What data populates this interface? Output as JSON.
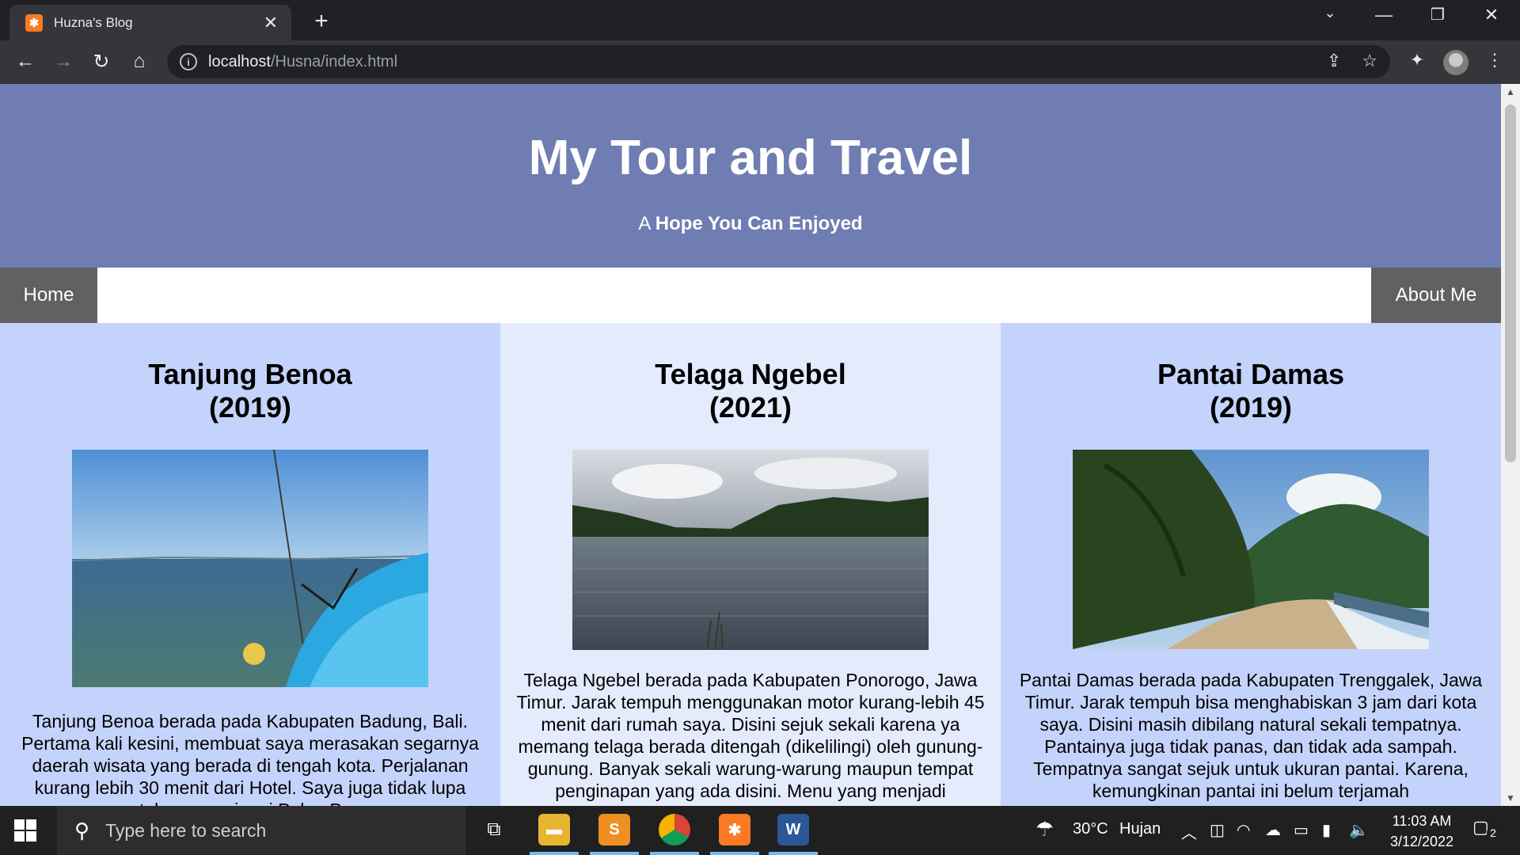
{
  "browser": {
    "tab_title": "Huzna's Blog",
    "tab_favicon": "xampp-icon",
    "url_host": "localhost",
    "url_path": "/Husna/index.html"
  },
  "site": {
    "title": "My Tour and Travel",
    "subtitle_prefix": "A",
    "subtitle_bold": "Hope You Can Enjoyed",
    "nav": {
      "home": "Home",
      "about": "About Me"
    },
    "colors": {
      "header_bg": "#6f7db3",
      "nav_button_bg": "#616161",
      "col_a": "#c4d3fb",
      "col_b": "#e4ebfd"
    }
  },
  "articles": [
    {
      "title_line1": "Tanjung Benoa",
      "title_line2": "(2019)",
      "text": "Tanjung Benoa berada pada Kabupaten Badung, Bali. Pertama kali kesini, membuat saya merasakan segarnya daerah wisata yang berada di tengah kota. Perjalanan kurang lebih 30 menit dari Hotel. Saya juga tidak lupa untuk mengunjungi Pulau Penyu"
    },
    {
      "title_line1": "Telaga Ngebel",
      "title_line2": "(2021)",
      "text": "Telaga Ngebel berada pada Kabupaten Ponorogo, Jawa Timur. Jarak tempuh menggunakan motor kurang-lebih 45 menit dari rumah saya. Disini sejuk sekali karena ya memang telaga berada ditengah (dikelilingi) oleh gunung-gunung. Banyak sekali warung-warung maupun tempat penginapan yang ada disini. Menu yang menjadi"
    },
    {
      "title_line1": "Pantai Damas",
      "title_line2": "(2019)",
      "text": "Pantai Damas berada pada Kabupaten Trenggalek, Jawa Timur. Jarak tempuh bisa menghabiskan 3 jam dari kota saya. Disini masih dibilang natural sekali tempatnya. Pantainya juga tidak panas, dan tidak ada sampah. Tempatnya sangat sejuk untuk ukuran pantai. Karena, kemungkinan pantai ini belum terjamah"
    }
  ],
  "taskbar": {
    "search_placeholder": "Type here to search",
    "weather_temp": "30°C",
    "weather_desc": "Hujan",
    "time": "11:03 AM",
    "date": "3/12/2022",
    "notification_count": "2"
  }
}
